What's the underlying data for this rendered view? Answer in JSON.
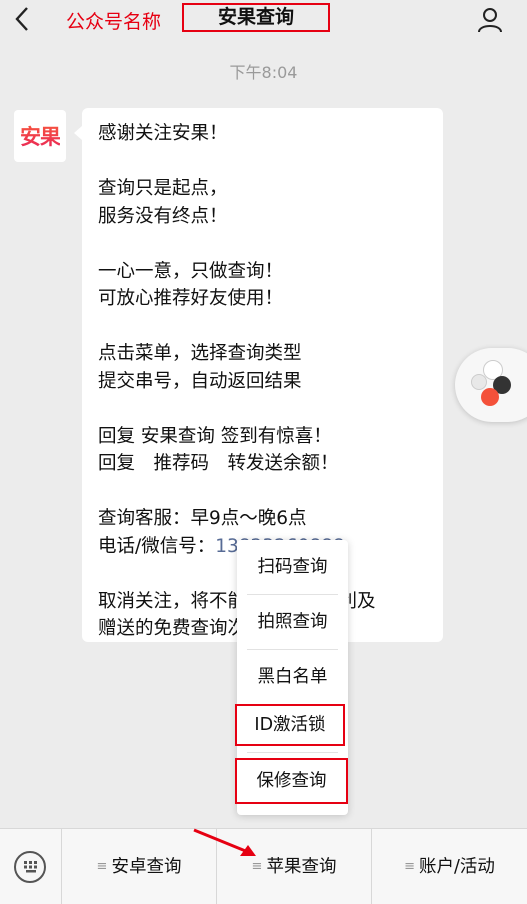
{
  "header": {
    "account_name": "公众号名称",
    "title": "安果查询"
  },
  "timestamp": "下午8:04",
  "avatar": {
    "text": "安果"
  },
  "message": {
    "lines": [
      "感谢关注安果！",
      "",
      "查询只是起点，",
      "服务没有终点！",
      "",
      "一心一意，只做查询！",
      "可放心推荐好友使用！",
      "",
      "点击菜单，选择查询类型",
      "提交串号，自动返回结果",
      "",
      "回复 安果查询 签到有惊喜！",
      "回复　推荐码　转发送余额！",
      "",
      "查询客服：早9点～晚6点"
    ],
    "phone_label": "电话/微信号：",
    "phone_number": "13823260888",
    "line_after_1": "取消关注，将不能享受会员福利及",
    "line_after_2": "赠送的免费查询次数哦！"
  },
  "popup_menu": {
    "items": [
      "扫码查询",
      "拍照查询",
      "黑白名单",
      "ID激活锁",
      "保修查询"
    ]
  },
  "bottom_menu": {
    "tabs": [
      "安卓查询",
      "苹果查询",
      "账户/活动"
    ]
  },
  "colors": {
    "annotation_red": "#e60012",
    "link_blue": "#576b95"
  },
  "icons": {
    "back": "chevron-left-icon",
    "profile": "person-icon",
    "keyboard": "keyboard-icon",
    "menu_lines": "menu-lines-icon"
  }
}
